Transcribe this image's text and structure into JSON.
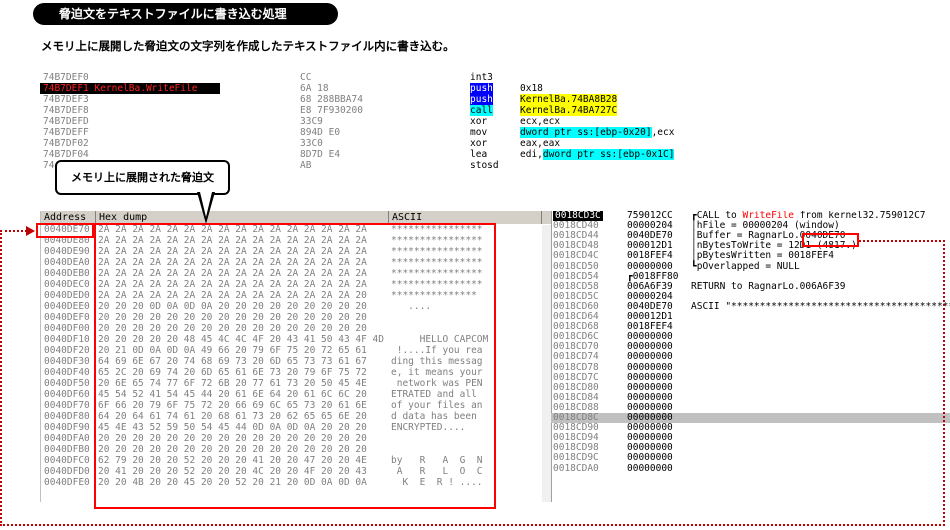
{
  "header": {
    "section_title": "脅迫文をテキストファイルに書き込む処理",
    "subtitle": "メモリ上に展開した脅迫文の文字列を作成したテキストファイル内に書き込む。"
  },
  "disasm": {
    "rows": [
      {
        "addr": "74B7DEF0",
        "bytes": "CC",
        "mnemonic": "int3",
        "operand": ""
      },
      {
        "addr": "74B7DEF1 KernelBa.WriteFile",
        "bytes": "6A 18",
        "mnemonic": "push",
        "operand": "0x18"
      },
      {
        "addr": "74B7DEF3",
        "bytes": "68 288BBA74",
        "mnemonic": "push",
        "operand": "KernelBa.74BA8B28"
      },
      {
        "addr": "74B7DEF8",
        "bytes": "E8 7F930200",
        "mnemonic": "call",
        "operand": "KernelBa.74BA727C"
      },
      {
        "addr": "74B7DEFD",
        "bytes": "33C9",
        "mnemonic": "xor",
        "operand": "ecx,ecx"
      },
      {
        "addr": "74B7DEFF",
        "bytes": "894D E0",
        "mnemonic": "mov",
        "operand_hl": "dword ptr ss:[ebp-0x20]",
        "operand_tail": ",ecx"
      },
      {
        "addr": "74B7DF02",
        "bytes": "33C0",
        "mnemonic": "xor",
        "operand": "eax,eax"
      },
      {
        "addr": "74B7DF04",
        "bytes": "8D7D E4",
        "mnemonic": "lea",
        "operand_pre": "edi,",
        "operand_hl": "dword ptr ss:[ebp-0x1C]"
      },
      {
        "addr": "74",
        "bytes": "AB",
        "mnemonic": "stosd",
        "operand": ""
      }
    ]
  },
  "callout": {
    "text": "メモリ上に展開された脅迫文"
  },
  "dump": {
    "headers": {
      "address": "Address",
      "hex": "Hex dump",
      "ascii": "ASCII"
    },
    "rows": [
      {
        "a": "0040DE70",
        "h": "2A 2A 2A 2A 2A 2A 2A 2A 2A 2A 2A 2A 2A 2A 2A 2A",
        "s": "****************"
      },
      {
        "a": "0040DE80",
        "h": "2A 2A 2A 2A 2A 2A 2A 2A 2A 2A 2A 2A 2A 2A 2A 2A",
        "s": "****************"
      },
      {
        "a": "0040DE90",
        "h": "2A 2A 2A 2A 2A 2A 2A 2A 2A 2A 2A 2A 2A 2A 2A 2A",
        "s": "****************"
      },
      {
        "a": "0040DEA0",
        "h": "2A 2A 2A 2A 2A 2A 2A 2A 2A 2A 2A 2A 2A 2A 2A 2A",
        "s": "****************"
      },
      {
        "a": "0040DEB0",
        "h": "2A 2A 2A 2A 2A 2A 2A 2A 2A 2A 2A 2A 2A 2A 2A 2A",
        "s": "****************"
      },
      {
        "a": "0040DEC0",
        "h": "2A 2A 2A 2A 2A 2A 2A 2A 2A 2A 2A 2A 2A 2A 2A 2A",
        "s": "****************"
      },
      {
        "a": "0040DED0",
        "h": "2A 2A 2A 2A 2A 2A 2A 2A 2A 2A 2A 2A 2A 2A 2A 20",
        "s": "*************** "
      },
      {
        "a": "0040DEE0",
        "h": "20 20 20 0D 0A 0D 0A 20 20 20 20 20 20 20 20 20",
        "s": "   ....         "
      },
      {
        "a": "0040DEF0",
        "h": "20 20 20 20 20 20 20 20 20 20 20 20 20 20 20 20",
        "s": "                "
      },
      {
        "a": "0040DF00",
        "h": "20 20 20 20 20 20 20 20 20 20 20 20 20 20 20 20",
        "s": "                "
      },
      {
        "a": "0040DF10",
        "h": "20 20 20 20 20 48 45 4C 4C 4F 20 43 41 50 43 4F 4D",
        "s": "     HELLO CAPCOM"
      },
      {
        "a": "0040DF20",
        "h": "20 21 0D 0A 0D 0A 49 66 20 79 6F 75 20 72 65 61",
        "s": " !....If you rea"
      },
      {
        "a": "0040DF30",
        "h": "64 69 6E 67 20 74 68 69 73 20 6D 65 73 73 61 67",
        "s": "ding this messag"
      },
      {
        "a": "0040DF40",
        "h": "65 2C 20 69 74 20 6D 65 61 6E 73 20 79 6F 75 72",
        "s": "e, it means your"
      },
      {
        "a": "0040DF50",
        "h": "20 6E 65 74 77 6F 72 6B 20 77 61 73 20 50 45 4E",
        "s": " network was PEN"
      },
      {
        "a": "0040DF60",
        "h": "45 54 52 41 54 45 44 20 61 6E 64 20 61 6C 6C 20",
        "s": "ETRATED and all "
      },
      {
        "a": "0040DF70",
        "h": "6F 66 20 79 6F 75 72 20 66 69 6C 65 73 20 61 6E",
        "s": "of your files an"
      },
      {
        "a": "0040DF80",
        "h": "64 20 64 61 74 61 20 68 61 73 20 62 65 65 6E 20",
        "s": "d data has been "
      },
      {
        "a": "0040DF90",
        "h": "45 4E 43 52 59 50 54 45 44 0D 0A 0D 0A 20 20 20",
        "s": "ENCRYPTED....   "
      },
      {
        "a": "0040DFA0",
        "h": "20 20 20 20 20 20 20 20 20 20 20 20 20 20 20 20",
        "s": "                "
      },
      {
        "a": "0040DFB0",
        "h": "20 20 20 20 20 20 20 20 20 20 20 20 20 20 20 20",
        "s": "                "
      },
      {
        "a": "0040DFC0",
        "h": "62 79 20 20 20 52 20 20 20 41 20 20 47 20 20 4E",
        "s": "by   R   A  G  N"
      },
      {
        "a": "0040DFD0",
        "h": "20 41 20 20 20 52 20 20 20 4C 20 20 4F 20 20 43",
        "s": " A   R   L  O  C"
      },
      {
        "a": "0040DFE0",
        "h": "20 20 4B 20 20 45 20 20 52 20 21 20 0D 0A 0D 0A",
        "s": "  K  E  R ! ...."
      }
    ]
  },
  "stack": {
    "rows": [
      {
        "a": "0018CD3C",
        "v": "759012CC",
        "c": "┏CALL to WriteFile from kernel32.759012C7",
        "type": "call"
      },
      {
        "a": "0018CD40",
        "v": "00000204",
        "c": "│hFile = 00000204 (window)"
      },
      {
        "a": "0018CD44",
        "v": "0040DE70",
        "c": "│Buffer = RagnarLo.0040DE70",
        "type": "buffer"
      },
      {
        "a": "0018CD48",
        "v": "000012D1",
        "c": "│nBytesToWrite = 12D1 (4817.)"
      },
      {
        "a": "0018CD4C",
        "v": "0018FEF4",
        "c": "│pBytesWritten = 0018FEF4"
      },
      {
        "a": "0018CD50",
        "v": "00000000",
        "c": "┗pOverlapped = NULL"
      },
      {
        "a": "0018CD54",
        "v": "┏0018FF80",
        "c": ""
      },
      {
        "a": "0018CD58",
        "v": "006A6F39",
        "c": "RETURN to RagnarLo.006A6F39",
        "type": "ret"
      },
      {
        "a": "0018CD5C",
        "v": "00000204",
        "c": ""
      },
      {
        "a": "0018CD60",
        "v": "0040DE70",
        "c": "ASCII \"***************************************",
        "type": "ascii"
      },
      {
        "a": "0018CD64",
        "v": "000012D1",
        "c": ""
      },
      {
        "a": "0018CD68",
        "v": "0018FEF4",
        "c": ""
      },
      {
        "a": "0018CD6C",
        "v": "00000000",
        "c": ""
      },
      {
        "a": "0018CD70",
        "v": "00000000",
        "c": ""
      },
      {
        "a": "0018CD74",
        "v": "00000000",
        "c": ""
      },
      {
        "a": "0018CD78",
        "v": "00000000",
        "c": ""
      },
      {
        "a": "0018CD7C",
        "v": "00000000",
        "c": ""
      },
      {
        "a": "0018CD80",
        "v": "00000000",
        "c": ""
      },
      {
        "a": "0018CD84",
        "v": "00000000",
        "c": ""
      },
      {
        "a": "0018CD88",
        "v": "00000000",
        "c": ""
      },
      {
        "a": "0018CD8C",
        "v": "00000000",
        "c": "",
        "type": "sel"
      },
      {
        "a": "0018CD90",
        "v": "00000000",
        "c": ""
      },
      {
        "a": "0018CD94",
        "v": "00000000",
        "c": ""
      },
      {
        "a": "0018CD98",
        "v": "00000000",
        "c": ""
      },
      {
        "a": "0018CD9C",
        "v": "00000000",
        "c": ""
      },
      {
        "a": "0018CDA0",
        "v": "00000000",
        "c": ""
      }
    ]
  },
  "colors": {
    "annotation_red": "#ff0000",
    "selection_black": "#000000",
    "highlight_yellow": "#ffff00",
    "highlight_cyan": "#00ffff"
  }
}
